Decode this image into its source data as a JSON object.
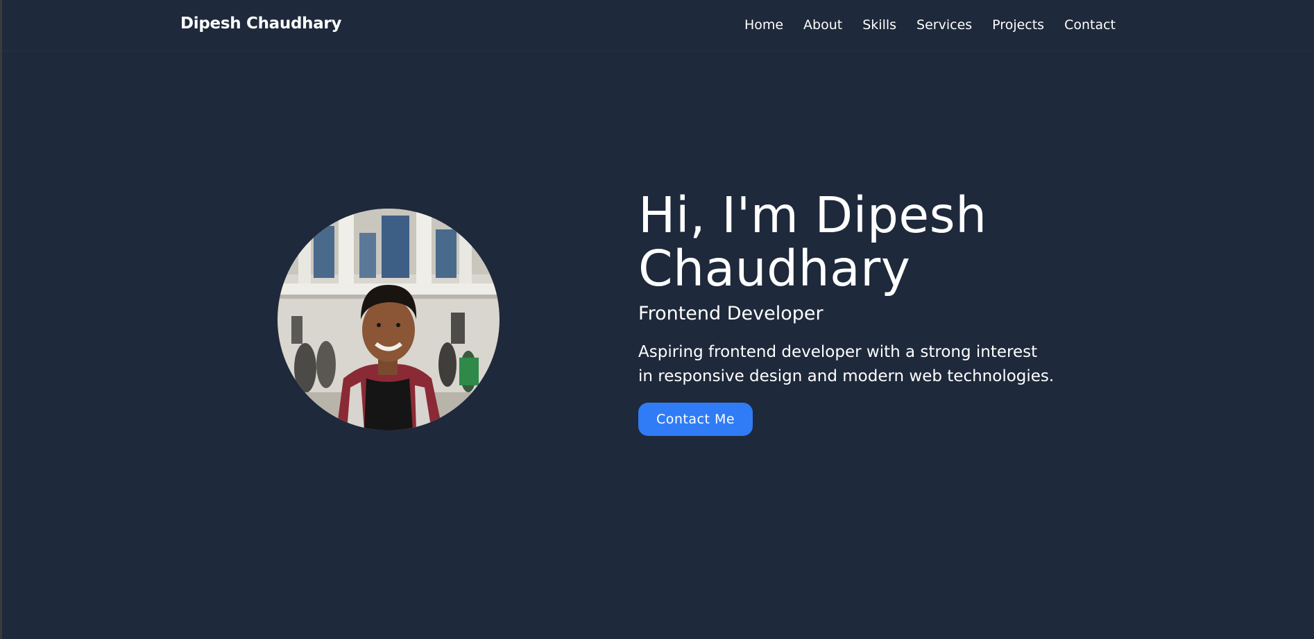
{
  "nav": {
    "brand": "Dipesh Chaudhary",
    "links": [
      "Home",
      "About",
      "Skills",
      "Services",
      "Projects",
      "Contact"
    ]
  },
  "hero": {
    "title": "Hi, I'm Dipesh Chaudhary",
    "subtitle": "Frontend Developer",
    "description": "Aspiring frontend developer with a strong interest in responsive design and modern web technologies.",
    "cta_label": "Contact Me"
  },
  "colors": {
    "background": "#1e293b",
    "accent": "#2f7cf6",
    "text": "#ffffff"
  }
}
